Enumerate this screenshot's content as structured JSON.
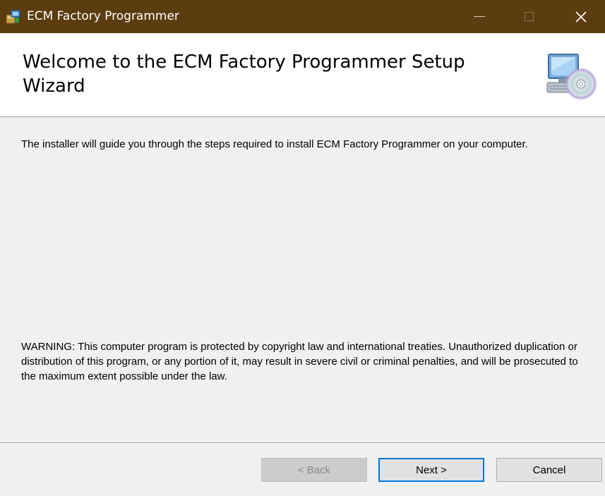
{
  "window": {
    "title": "ECM Factory Programmer",
    "controls": {
      "minimize": "minimize-icon",
      "maximize": "maximize-icon",
      "close": "close-icon"
    }
  },
  "header": {
    "title": "Welcome to the ECM Factory Programmer Setup Wizard",
    "icon": "computer-cd-icon"
  },
  "content": {
    "intro": "The installer will guide you through the steps required to install ECM Factory Programmer on your computer.",
    "warning": "WARNING: This computer program is protected by copyright law and international treaties. Unauthorized duplication or distribution of this program, or any portion of it, may result in severe civil or criminal penalties, and will be prosecuted to the maximum extent possible under the law."
  },
  "buttons": {
    "back": "< Back",
    "next": "Next >",
    "cancel": "Cancel"
  },
  "colors": {
    "titlebar": "#5b3d0f",
    "focus_border": "#0078d7",
    "background": "#f0f0f0"
  }
}
